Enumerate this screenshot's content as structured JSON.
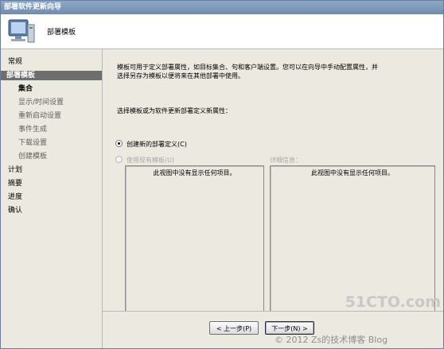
{
  "window": {
    "title": "部署软件更新向导"
  },
  "banner": {
    "title": "部署模板",
    "icon": "computer-icon"
  },
  "nav": {
    "items": [
      {
        "label": "常规",
        "state": "normal"
      },
      {
        "label": "部署模板",
        "state": "active"
      },
      {
        "label": "集合",
        "state": "bold"
      },
      {
        "label": "显示/时间设置",
        "state": "sub"
      },
      {
        "label": "重新启动设置",
        "state": "sub"
      },
      {
        "label": "事件生成",
        "state": "sub"
      },
      {
        "label": "下载设置",
        "state": "sub"
      },
      {
        "label": "创建模板",
        "state": "sub"
      },
      {
        "label": "计划",
        "state": "normal"
      },
      {
        "label": "摘要",
        "state": "normal"
      },
      {
        "label": "进度",
        "state": "normal"
      },
      {
        "label": "确认",
        "state": "normal"
      }
    ]
  },
  "content": {
    "description_line1": "模板可用于定义部署属性，如目标集合、句和客户端设置。您可以在向导中手动配置属性，并",
    "description_line2": "选择另存为模板以便将来在其他部署中使用。",
    "prompt": "选择模板或为软件更新部署定义新属性：",
    "option_new": "创建新的部署定义(C)",
    "option_existing": "使用现有模板(U)",
    "details_label": "详细信息：",
    "templates_empty": "此视图中没有显示任何项目。",
    "details_empty": "此视图中没有显示任何项目。"
  },
  "buttons": {
    "prev": "< 上一步(P)",
    "next": "下一步(N) >"
  },
  "watermark": {
    "logo": "51CTO.com",
    "text": "© 2012 Zs的技术博客 Blog"
  }
}
